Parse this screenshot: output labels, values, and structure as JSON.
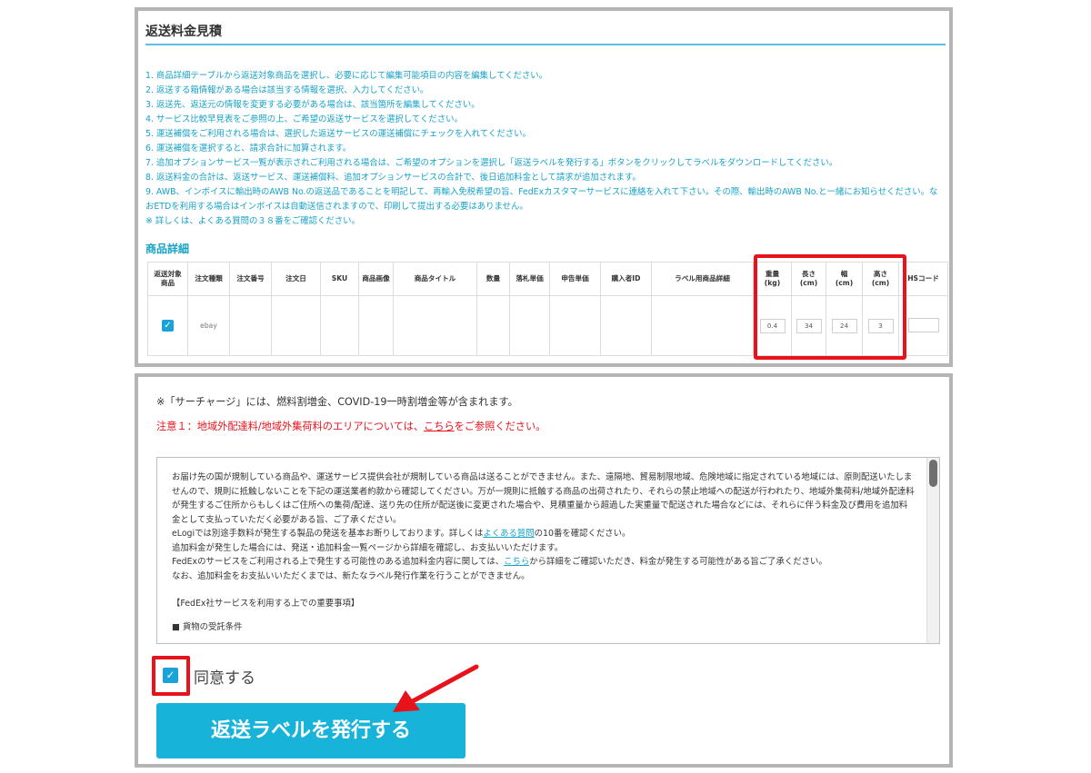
{
  "top_panel": {
    "title": "返送料金見積",
    "instructions": [
      "1. 商品詳細テーブルから返送対象商品を選択し、必要に応じて編集可能項目の内容を編集してください。",
      "2. 返送する箱情報がある場合は該当する情報を選択、入力してください。",
      "3. 返送先、返送元の情報を変更する必要がある場合は、該当箇所を編集してください。",
      "4. サービス比較早見表をご参照の上、ご希望の返送サービスを選択してください。",
      "5. 運送補償をご利用される場合は、選択した返送サービスの運送補償にチェックを入れてください。",
      "6. 運送補償を選択すると、請求合計に加算されます。",
      "7. 追加オプションサービス一覧が表示されご利用される場合は、ご希望のオプションを選択し「返送ラベルを発行する」ボタンをクリックしてラベルをダウンロードしてください。",
      "8. 返送料金の合計は、返送サービス、運送補償料、追加オプションサービスの合計で、後日追加料金として請求が追加されます。",
      "9. AWB、インボイスに輸出時のAWB No.の返送品であることを明記して、再輸入免税希望の旨、FedExカスタマーサービスに連絡を入れて下さい。その際、輸出時のAWB No.と一緒にお知らせください。なおETDを利用する場合はインボイスは自動送信されますので、印刷して提出する必要はありません。",
      "※ 詳しくは、よくある質問の３８番をご確認ください。"
    ],
    "goods_title": "商品詳細",
    "table": {
      "headers": [
        "返送対象\n商品",
        "注文種類",
        "注文番号",
        "注文日",
        "SKU",
        "商品画像",
        "商品タイトル",
        "数量",
        "落札単価",
        "申告単価",
        "購入者ID",
        "ラベル用商品詳細",
        "重量\n(kg)",
        "長さ\n(cm)",
        "幅\n(cm)",
        "高さ\n(cm)",
        "HSコード"
      ],
      "row": {
        "order_type": "ebay",
        "weight": "0.4",
        "length": "34",
        "width": "24",
        "height": "3",
        "hs_code": ""
      }
    }
  },
  "bottom_panel": {
    "surcharge_note": "※「サーチャージ」には、燃料割増金、COVID-19一時割増金等が含まれます。",
    "warning_prefix": "注意１：地域外配達料/地域外集荷料のエリアについては、",
    "warning_link": "こちら",
    "warning_suffix": "をご参照ください。",
    "terms": {
      "para1": "お届け先の国が規制している商品や、運送サービス提供会社が規制している商品は送ることができません。また、遠隔地、貿易制限地域、危険地域に指定されている地域には、原則配送いたしませんので、規則に抵触しないことを下記の運送業者約款から確認してください。万が一規則に抵触する商品の出荷されたり、それらの禁止地域への配送が行われたり、地域外集荷料/地域外配達料が発生するご住所からもしくはご住所への集荷/配達、送り先の住所が配送後に変更された場合や、見積重量から超過した実重量で配送された場合などには、それらに伴う料金及び費用を追加料金として支払っていただく必要がある旨、ご了承ください。",
      "line2_prefix": "eLogiでは別途手数料が発生する製品の発送を基本お断りしております。詳しくは",
      "line2_link": "よくある質問",
      "line2_suffix": "の10番を確認ください。",
      "line3": "追加料金が発生した場合には、発送・追加料金一覧ページから詳細を確認し、お支払いいただけます。",
      "line4_prefix": "FedExのサービスをご利用される上で発生する可能性のある追加料金内容に関しては、",
      "line4_link": "こちら",
      "line4_suffix": "から詳細をご確認いただき、料金が発生する可能性がある旨ご了承ください。",
      "line5": "なお、追加料金をお支払いいただくまでは、新たなラベル発行作業を行うことができません。",
      "section_title": "【FedEx社サービスを利用する上での重要事項】",
      "bullet1": "■ 貨物の受託条件"
    },
    "agree_label": "同意する",
    "issue_button": "返送ラベルを発行する"
  },
  "colors": {
    "accent": "#17b3d9",
    "highlight": "#e8121b",
    "instruction_text": "#17a2c8"
  }
}
